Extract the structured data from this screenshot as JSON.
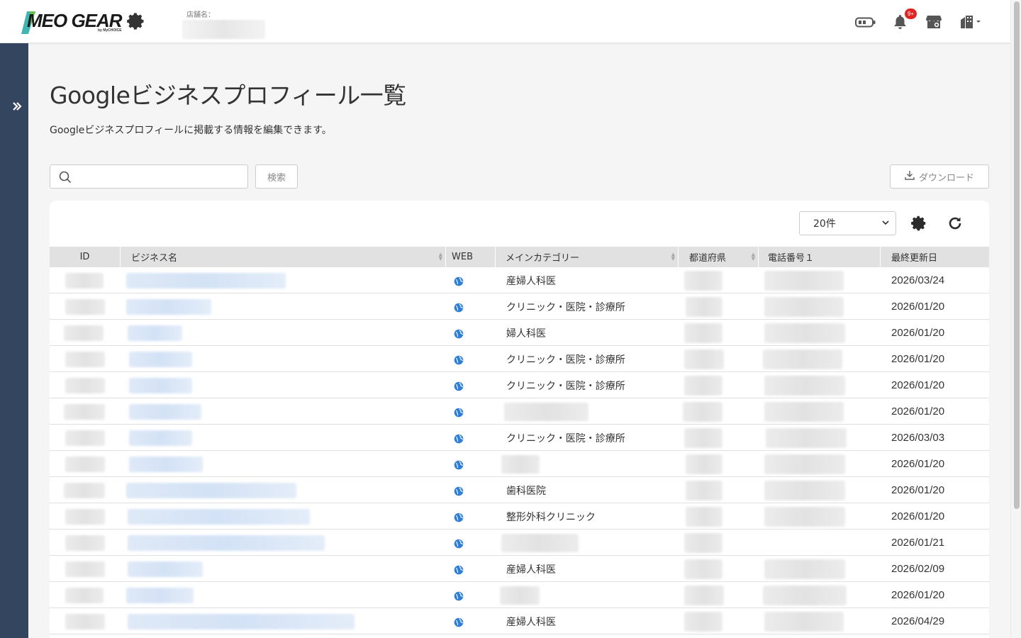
{
  "header": {
    "logo_text": "MEO GEAR",
    "logo_sub": "by MyCHOICE",
    "store_label": "店舗名：",
    "notification_badge": "9+"
  },
  "page": {
    "title": "Googleビジネスプロフィール一覧",
    "description": "Googleビジネスプロフィールに掲載する情報を編集できます。"
  },
  "toolbar": {
    "search_placeholder": "",
    "search_button": "検索",
    "download_button": "ダウンロード",
    "per_page": "20件"
  },
  "table": {
    "columns": [
      "ID",
      "ビジネス名",
      "WEB",
      "メインカテゴリー",
      "都道府県",
      "電話番号１",
      "最終更新日"
    ],
    "rows": [
      {
        "category": "産婦人科医",
        "date": "2026/03/24"
      },
      {
        "category": "クリニック・医院・診療所",
        "date": "2026/01/20"
      },
      {
        "category": "婦人科医",
        "date": "2026/01/20"
      },
      {
        "category": "クリニック・医院・診療所",
        "date": "2026/01/20"
      },
      {
        "category": "クリニック・医院・診療所",
        "date": "2026/01/20"
      },
      {
        "category": "",
        "date": "2026/01/20"
      },
      {
        "category": "クリニック・医院・診療所",
        "date": "2026/03/03"
      },
      {
        "category": "",
        "date": "2026/01/20"
      },
      {
        "category": "歯科医院",
        "date": "2026/01/20"
      },
      {
        "category": "整形外科クリニック",
        "date": "2026/01/20"
      },
      {
        "category": "",
        "date": "2026/01/21"
      },
      {
        "category": "産婦人科医",
        "date": "2026/02/09"
      },
      {
        "category": "",
        "date": "2026/01/20"
      },
      {
        "category": "産婦人科医",
        "date": "2026/04/29"
      }
    ]
  },
  "colors": {
    "sidebar": "#34465f",
    "badge": "#e02424",
    "globe": "#2f7fd6",
    "table_header": "#e1e1e1"
  },
  "icons": [
    "expand-sidebar-icon",
    "battery-icon",
    "bell-icon",
    "store-icon",
    "building-icon",
    "search-icon",
    "download-icon",
    "gear-icon",
    "refresh-icon",
    "globe-icon"
  ]
}
